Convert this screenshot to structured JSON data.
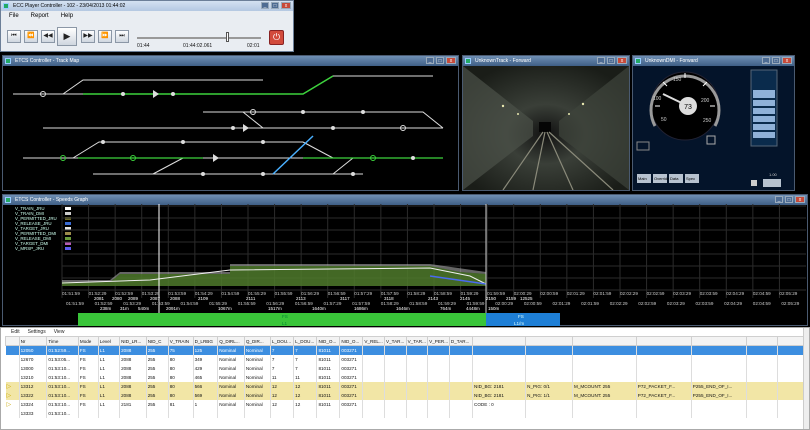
{
  "player": {
    "title": "ECC Player Controller - 102 - 23/04/2013 01:44:02",
    "menu": [
      "File",
      "Report",
      "Help"
    ],
    "buttons": [
      "⏮",
      "⏪",
      "◀◀",
      "▶",
      "▶▶",
      "⏩",
      "⏭"
    ],
    "time_start": "01:44",
    "time_current": "01:44:02.061",
    "time_end": "02:01",
    "progress": 0.73
  },
  "trackmap": {
    "title": "ETCS Controller - Track Map"
  },
  "camera": {
    "title": "UnknownTrack - Forward"
  },
  "dmi": {
    "title": "UnknownDMI - Forward",
    "speed": "73",
    "scale": [
      "50",
      "100",
      "150",
      "200",
      "250"
    ],
    "buttons": [
      "Main",
      "Override",
      "Data",
      "Spec"
    ],
    "right_value": "1.00"
  },
  "speed_graph": {
    "title": "ETCS Controller - Speeds Graph",
    "legend": [
      {
        "label": "V_TRAIN_JRU",
        "color": "#ffffff"
      },
      {
        "label": "V_TRAIN_DMI",
        "color": "#cccccc"
      },
      {
        "label": "V_PERMITTED_JRU",
        "color": "#6b6b2a"
      },
      {
        "label": "V_RELEASE_JRU",
        "color": "#3a6bd4"
      },
      {
        "label": "V_TARGET_JRU",
        "color": "#e8e8e8"
      },
      {
        "label": "V_PERMITTED_DMI",
        "color": "#9b8b4b"
      },
      {
        "label": "V_RELEASE_DMI",
        "color": "#6a9c3c"
      },
      {
        "label": "V_TARGET_DMI",
        "color": "#b45cb4"
      },
      {
        "label": "V_MRSP_JRU",
        "color": "#5c5cf0"
      }
    ],
    "x_ticks": [
      "01:51:59",
      "01:52:29",
      "01:52:59",
      "01:53:29",
      "01:53:59",
      "01:54:29",
      "01:54:59",
      "01:55:29",
      "01:55:59",
      "01:56:29",
      "01:56:59",
      "01:57:29",
      "01:57:59",
      "01:58:29",
      "01:58:59",
      "01:59:29",
      "01:59:59",
      "02:00:29",
      "02:00:59",
      "02:01:29",
      "02:01:59",
      "02:02:29",
      "02:02:59",
      "02:03:29",
      "02:03:59",
      "02:04:29",
      "02:04:59",
      "02:05:29"
    ],
    "x_ticks_top": [
      "01:51:59",
      "01:52:59",
      "01:53:29",
      "01:53:59",
      "01:54:59",
      "01:55:29",
      "01:55:59",
      "01:56:29",
      "01:56:59",
      "01:57:29",
      "01:57:59",
      "01:58:29",
      "01:58:59",
      "01:59:29",
      "01:59:59",
      "02:00:29",
      "02:00:59",
      "02:01:29",
      "02:01:59",
      "02:02:29",
      "02:02:59",
      "02:03:29",
      "02:03:59",
      "02:04:29",
      "02:04:59",
      "02:05:29"
    ],
    "balises": [
      "2081",
      "2080",
      "2089",
      "2087",
      "2088",
      "2109",
      "2111",
      "2113",
      "3117",
      "3118",
      "2143",
      "2145",
      "2150",
      "2159",
      "12525"
    ],
    "distances": [
      "238m",
      "31m",
      "540m",
      "2091m",
      "1067m",
      "1517m",
      "1640m",
      "1686m",
      "1646m",
      "764m",
      "4448m",
      "150m"
    ],
    "bar_green_label": "FS",
    "bar_green_sub": "L1",
    "bar_blue_label": "FS",
    "bar_blue_sub": "L1/m"
  },
  "table": {
    "menu": [
      "Edit",
      "Settings",
      "View"
    ],
    "columns": [
      "",
      "Nr",
      "Time",
      "Mode",
      "Level",
      "NID_LR...",
      "NID_C",
      "V_TRAIN",
      "D_LRBG",
      "Q_DIRL...",
      "Q_DIR...",
      "L_DOU...",
      "L_DOU...",
      "NID_O...",
      "NID_O...",
      "V_REL...",
      "V_TAR...",
      "V_TAR...",
      "V_PER...",
      "D_TAR...",
      "",
      "",
      "",
      "",
      "",
      "",
      ""
    ],
    "rows": [
      {
        "cls": "sel",
        "cells": [
          "",
          "12050",
          "01:52:59...",
          "FS",
          "L1",
          "2088",
          "255",
          "75",
          "125",
          "Nominal",
          "Nominal",
          "7",
          "7",
          "81011",
          "003271",
          "",
          "",
          "",
          "",
          "",
          "",
          "",
          "",
          "",
          "",
          "",
          ""
        ]
      },
      {
        "cls": "",
        "cells": [
          "",
          "12670",
          "01:53:05...",
          "FS",
          "L1",
          "2088",
          "255",
          "80",
          "349",
          "Nominal",
          "Nominal",
          "7",
          "7",
          "81011",
          "003271",
          "",
          "",
          "",
          "",
          "",
          "",
          "",
          "",
          "",
          "",
          "",
          ""
        ]
      },
      {
        "cls": "",
        "cells": [
          "",
          "13000",
          "01:53:10...",
          "FS",
          "L1",
          "2088",
          "255",
          "80",
          "429",
          "Nominal",
          "Nominal",
          "7",
          "7",
          "81011",
          "003271",
          "",
          "",
          "",
          "",
          "",
          "",
          "",
          "",
          "",
          "",
          "",
          ""
        ]
      },
      {
        "cls": "",
        "cells": [
          "",
          "13210",
          "01:53:10...",
          "FS",
          "L1",
          "2088",
          "255",
          "80",
          "465",
          "Nominal",
          "Nominal",
          "11",
          "11",
          "81011",
          "003271",
          "",
          "",
          "",
          "",
          "",
          "",
          "",
          "",
          "",
          "",
          "",
          ""
        ]
      },
      {
        "cls": "hl",
        "cells": [
          "▷",
          "13312",
          "01:53:10...",
          "FS",
          "L1",
          "2088",
          "255",
          "80",
          "566",
          "Nominal",
          "Nominal",
          "12",
          "12",
          "81011",
          "003271",
          "",
          "",
          "",
          "",
          "",
          "NID_BG: 2181",
          "N_PIG: 0/1",
          "M_MCOUNT: 255",
          "P72_PACKET_F...",
          "P255_END_OF_I...",
          "",
          ""
        ]
      },
      {
        "cls": "hl",
        "cells": [
          "▷",
          "13322",
          "01:53:10...",
          "FS",
          "L1",
          "2088",
          "255",
          "80",
          "569",
          "Nominal",
          "Nominal",
          "12",
          "12",
          "81011",
          "003271",
          "",
          "",
          "",
          "",
          "",
          "NID_BG: 2181",
          "N_PIG: 1/1",
          "M_MCOUNT: 255",
          "P72_PACKET_F...",
          "P255_END_OF_I...",
          "",
          ""
        ]
      },
      {
        "cls": "",
        "cells": [
          "▷",
          "13324",
          "01:53:10...",
          "FS",
          "L1",
          "2181",
          "255",
          "81",
          "1",
          "Nominal",
          "Nominal",
          "12",
          "12",
          "81011",
          "003271",
          "",
          "",
          "",
          "",
          "",
          "CODE : 0",
          "",
          "",
          "",
          "",
          "",
          ""
        ]
      },
      {
        "cls": "",
        "cells": [
          "",
          "13333",
          "01:53:10...",
          "",
          "",
          "",
          "",
          "",
          "",
          "",
          "",
          "",
          "",
          "",
          "",
          "",
          "",
          "",
          "",
          "",
          "",
          "",
          "",
          "",
          "",
          "",
          ""
        ]
      }
    ]
  }
}
